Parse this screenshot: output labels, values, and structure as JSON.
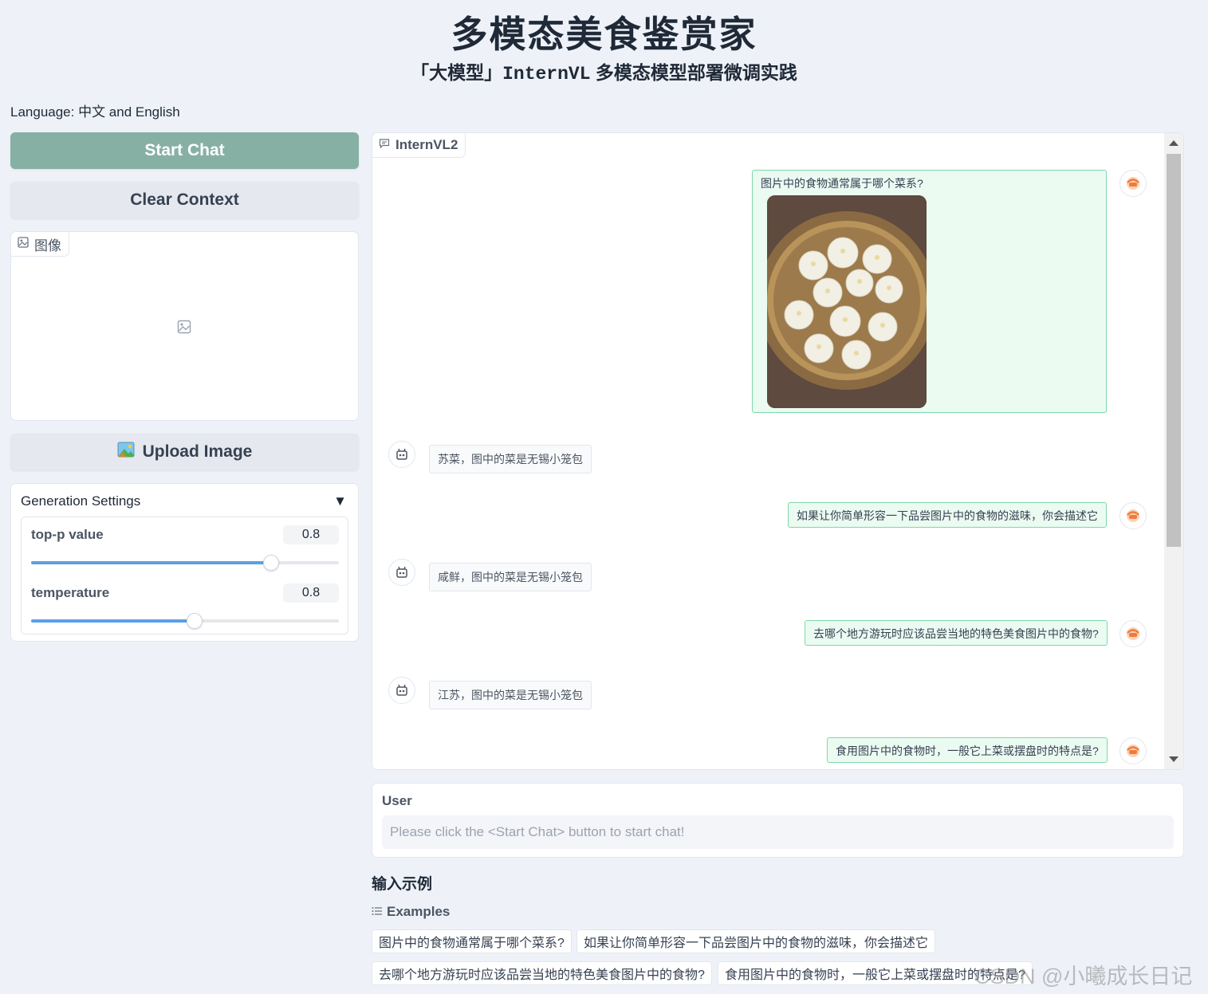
{
  "header": {
    "title": "多模态美食鉴赏家",
    "subtitle_prefix": "「大模型」",
    "subtitle_mono": "InternVL",
    "subtitle_suffix": " 多模态模型部署微调实践"
  },
  "language_label": "Language: 中文 and English",
  "buttons": {
    "start_chat": "Start Chat",
    "clear_context": "Clear Context",
    "upload_image": "Upload Image"
  },
  "image_panel": {
    "label": "图像"
  },
  "settings": {
    "title": "Generation Settings",
    "toggle": "▼",
    "top_p": {
      "label": "top-p value",
      "value": "0.8",
      "fraction": 0.78
    },
    "temperature": {
      "label": "temperature",
      "value": "0.8",
      "fraction": 0.53
    }
  },
  "chat": {
    "label": "InternVL2",
    "messages": [
      {
        "role": "user",
        "text": "图片中的食物通常属于哪个菜系?",
        "has_image": true
      },
      {
        "role": "bot",
        "text": "苏菜，图中的菜是无锡小笼包"
      },
      {
        "role": "user",
        "text": "如果让你简单形容一下品尝图片中的食物的滋味，你会描述它"
      },
      {
        "role": "bot",
        "text": "咸鲜，图中的菜是无锡小笼包"
      },
      {
        "role": "user",
        "text": "去哪个地方游玩时应该品尝当地的特色美食图片中的食物?"
      },
      {
        "role": "bot",
        "text": "江苏，图中的菜是无锡小笼包"
      },
      {
        "role": "user",
        "text": "食用图片中的食物时，一般它上菜或摆盘时的特点是?"
      }
    ]
  },
  "user_input": {
    "label": "User",
    "placeholder": "Please click the <Start Chat> button to start chat!"
  },
  "examples": {
    "title": "输入示例",
    "label": "Examples",
    "items": [
      "图片中的食物通常属于哪个菜系?",
      "如果让你简单形容一下品尝图片中的食物的滋味，你会描述它",
      "去哪个地方游玩时应该品尝当地的特色美食图片中的食物?",
      "食用图片中的食物时，一般它上菜或摆盘时的特点是?"
    ]
  },
  "watermark": "CSDN @小曦成长日记",
  "colors": {
    "start_button": "#87b0a4",
    "user_bubble_bg": "#ebfbf2",
    "user_bubble_border": "#7fd7a9",
    "slider_fill": "#5aa0e6",
    "page_bg": "#eef2f8"
  }
}
